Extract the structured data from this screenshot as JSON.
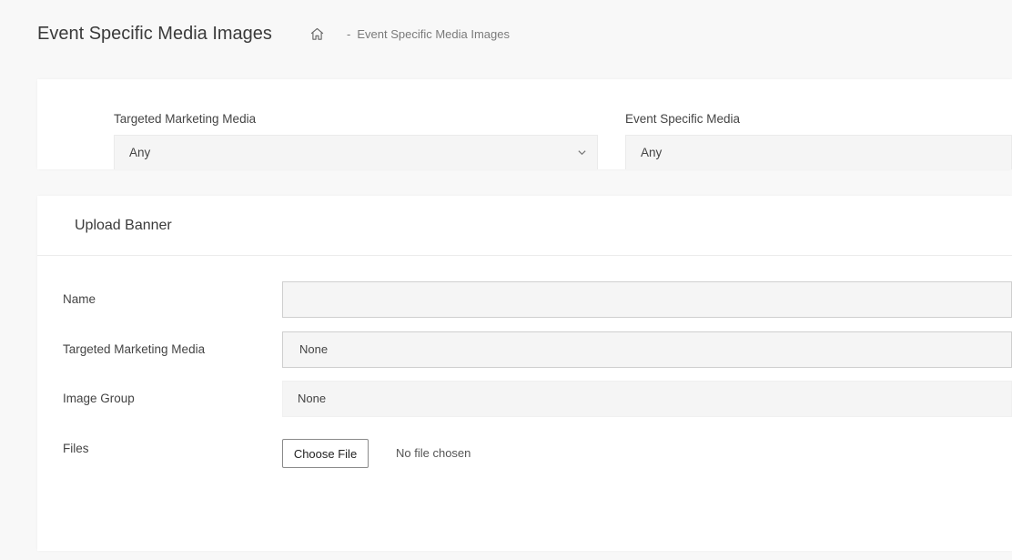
{
  "header": {
    "title": "Event Specific Media Images",
    "breadcrumb": {
      "separator": "-",
      "current": "Event Specific Media Images"
    }
  },
  "filters": {
    "targeted_marketing": {
      "label": "Targeted Marketing Media",
      "value": "Any"
    },
    "event_specific": {
      "label": "Event Specific Media",
      "value": "Any"
    }
  },
  "upload": {
    "title": "Upload Banner",
    "fields": {
      "name": {
        "label": "Name",
        "value": ""
      },
      "targeted_marketing": {
        "label": "Targeted Marketing Media",
        "value": "None"
      },
      "image_group": {
        "label": "Image Group",
        "value": "None"
      },
      "files": {
        "label": "Files",
        "button_label": "Choose File",
        "status": "No file chosen"
      }
    }
  },
  "icons": {
    "home": "home-icon",
    "chevron": "chevron-down-icon"
  },
  "colors": {
    "background": "#f8f8f8",
    "card": "#ffffff",
    "input_bg": "#f5f5f5",
    "text": "#444444"
  }
}
